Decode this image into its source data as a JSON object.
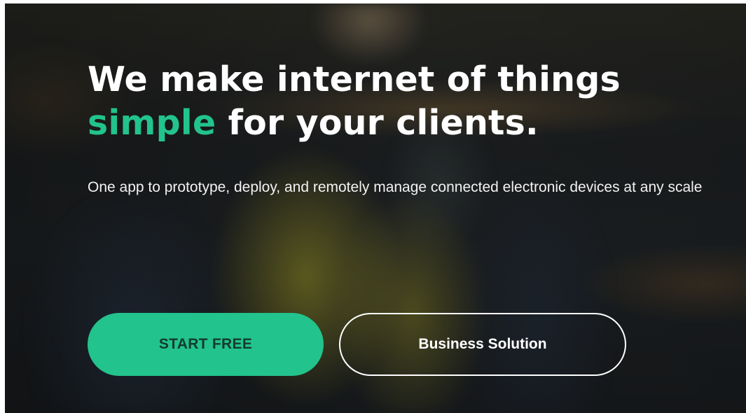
{
  "hero": {
    "headline_part1": "We make internet of things",
    "headline_accent": "simple",
    "headline_part2": " for your clients.",
    "subtitle": "One app to prototype, deploy, and remotely manage connected electronic devices at any scale",
    "background_icon": "blurred-photo-worker-in-safety-vest"
  },
  "buttons": {
    "primary_label": "START FREE",
    "secondary_label": "Business Solution"
  },
  "colors": {
    "accent": "#22c38c",
    "text": "#ffffff",
    "primary_button_text": "#143b2e"
  }
}
